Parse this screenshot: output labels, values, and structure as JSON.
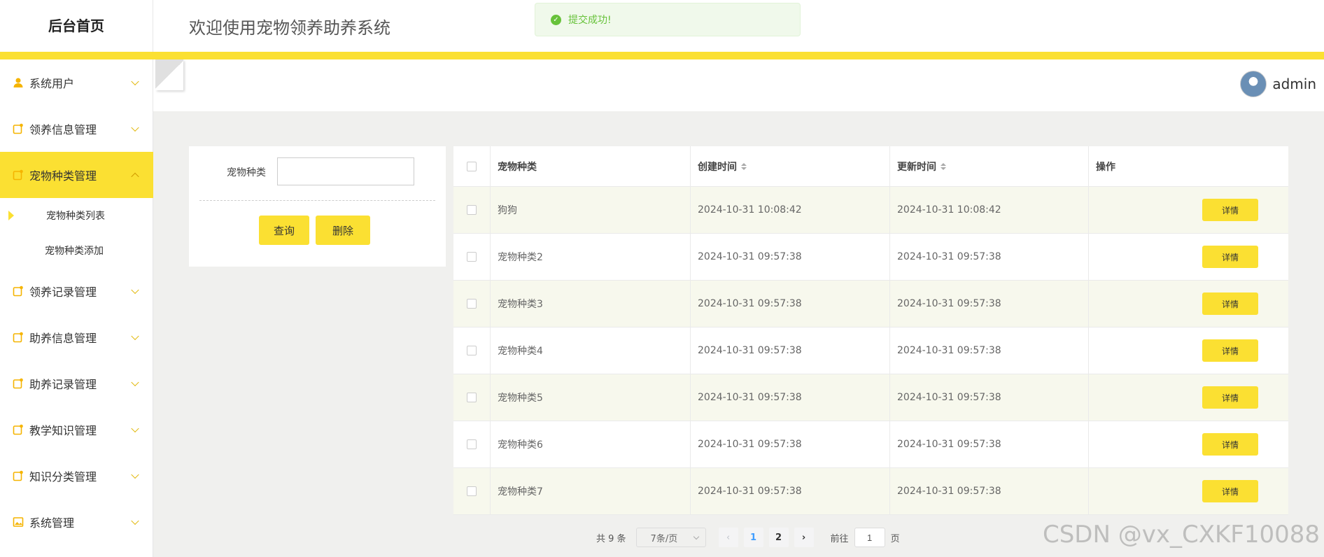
{
  "brand": "后台首页",
  "header": {
    "title": "欢迎使用宠物领养助养系统"
  },
  "toast": {
    "message": "提交成功!"
  },
  "user": {
    "name": "admin"
  },
  "sidebar": {
    "items": [
      {
        "label": "系统用户"
      },
      {
        "label": "领养信息管理"
      },
      {
        "label": "宠物种类管理"
      },
      {
        "label": "领养记录管理"
      },
      {
        "label": "助养信息管理"
      },
      {
        "label": "助养记录管理"
      },
      {
        "label": "教学知识管理"
      },
      {
        "label": "知识分类管理"
      },
      {
        "label": "系统管理"
      }
    ],
    "submenu": [
      {
        "label": "宠物种类列表"
      },
      {
        "label": "宠物种类添加"
      }
    ]
  },
  "search": {
    "label": "宠物种类",
    "value": "",
    "query_label": "查询",
    "delete_label": "删除"
  },
  "table": {
    "headers": {
      "name": "宠物种类",
      "created": "创建时间",
      "updated": "更新时间",
      "op": "操作"
    },
    "detail_label": "详情",
    "rows": [
      {
        "name": "狗狗",
        "created": "2024-10-31 10:08:42",
        "updated": "2024-10-31 10:08:42"
      },
      {
        "name": "宠物种类2",
        "created": "2024-10-31 09:57:38",
        "updated": "2024-10-31 09:57:38"
      },
      {
        "name": "宠物种类3",
        "created": "2024-10-31 09:57:38",
        "updated": "2024-10-31 09:57:38"
      },
      {
        "name": "宠物种类4",
        "created": "2024-10-31 09:57:38",
        "updated": "2024-10-31 09:57:38"
      },
      {
        "name": "宠物种类5",
        "created": "2024-10-31 09:57:38",
        "updated": "2024-10-31 09:57:38"
      },
      {
        "name": "宠物种类6",
        "created": "2024-10-31 09:57:38",
        "updated": "2024-10-31 09:57:38"
      },
      {
        "name": "宠物种类7",
        "created": "2024-10-31 09:57:38",
        "updated": "2024-10-31 09:57:38"
      }
    ]
  },
  "pager": {
    "total": "共 9 条",
    "page_size": "7条/页",
    "prev": "‹",
    "next": "›",
    "pages": [
      "1",
      "2"
    ],
    "jump_prefix": "前往",
    "jump_value": "1",
    "jump_suffix": "页"
  },
  "watermark": "CSDN @vx_CXKF10088",
  "colors": {
    "accent": "#fbe032",
    "success": "#67c23a",
    "page_active": "#409eff"
  }
}
